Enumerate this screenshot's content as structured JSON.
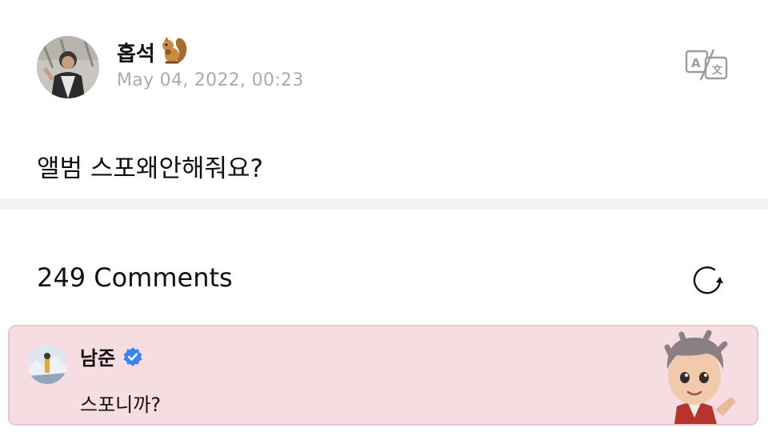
{
  "post": {
    "author": {
      "name": "홉석",
      "emoji": "🐿️"
    },
    "time": "May 04, 2022, 00:23",
    "body": "앨범 스포왜안해줘요?"
  },
  "comments": {
    "count_label": "249 Comments",
    "items": [
      {
        "author": "남준",
        "verified": true,
        "text": "스포니까?",
        "highlight_color": "#f6dde1"
      }
    ]
  },
  "icons": {
    "translate": "translate-icon",
    "refresh": "refresh-icon",
    "verified": "verified-badge-icon"
  },
  "colors": {
    "timestamp": "#a9abb3",
    "highlight_bg": "#f6dde1",
    "verified_blue": "#3b82f6"
  }
}
